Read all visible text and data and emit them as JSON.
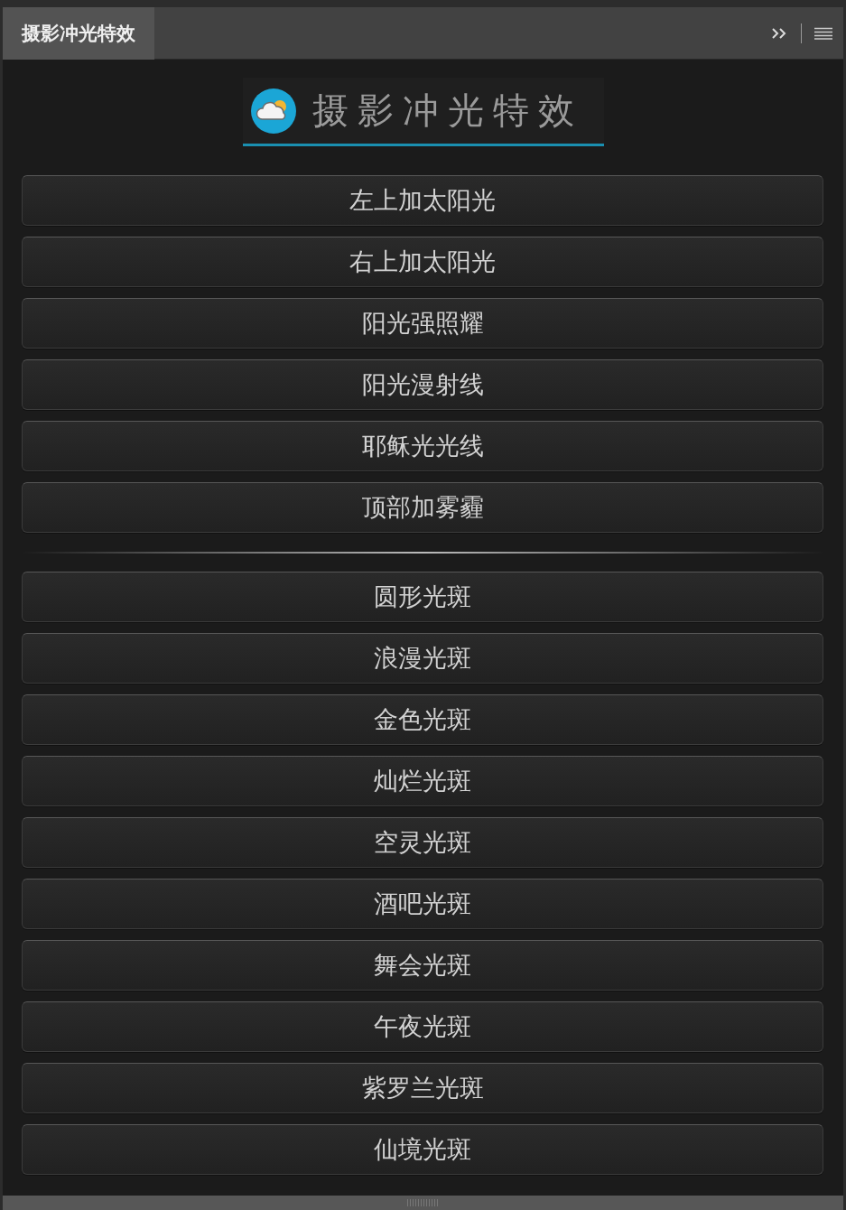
{
  "panel": {
    "tab": {
      "label": "摄影冲光特效",
      "selected": true
    }
  },
  "logo": {
    "title": "摄影冲光特效"
  },
  "groups": [
    {
      "buttons": [
        "左上加太阳光",
        "右上加太阳光",
        "阳光强照耀",
        "阳光漫射线",
        "耶稣光光线",
        "顶部加雾霾"
      ]
    },
    {
      "buttons": [
        "圆形光斑",
        "浪漫光斑",
        "金色光斑",
        "灿烂光斑",
        "空灵光斑",
        "酒吧光斑",
        "舞会光斑",
        "午夜光斑",
        "紫罗兰光斑",
        "仙境光斑"
      ]
    }
  ]
}
